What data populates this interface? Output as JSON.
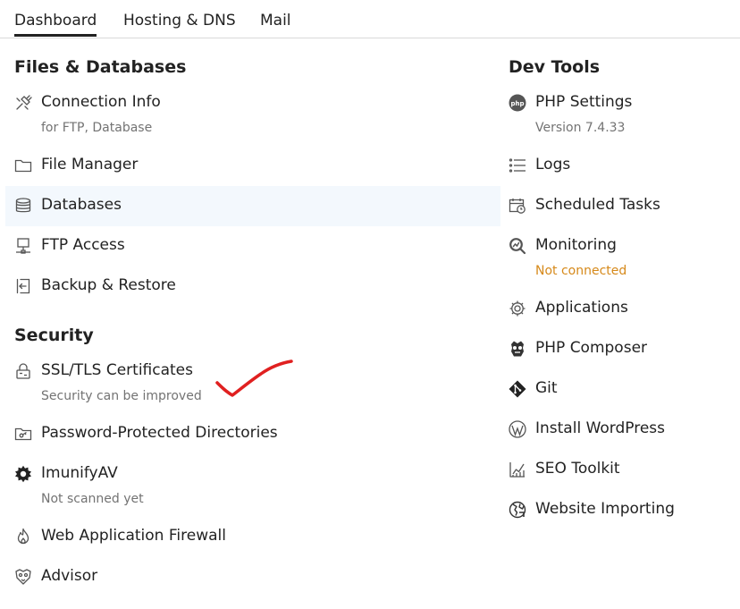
{
  "tabs": [
    {
      "label": "Dashboard",
      "active": true
    },
    {
      "label": "Hosting & DNS",
      "active": false
    },
    {
      "label": "Mail",
      "active": false
    }
  ],
  "left": {
    "files_title": "Files & Databases",
    "files_items": [
      {
        "label": "Connection Info",
        "sub": "for FTP, Database",
        "icon": "plug-icon"
      },
      {
        "label": "File Manager",
        "icon": "folder-icon"
      },
      {
        "label": "Databases",
        "icon": "database-icon"
      },
      {
        "label": "FTP Access",
        "icon": "ftp-network-icon"
      },
      {
        "label": "Backup & Restore",
        "icon": "backup-icon"
      }
    ],
    "security_title": "Security",
    "security_items": [
      {
        "label": "SSL/TLS Certificates",
        "sub": "Security can be improved",
        "icon": "ssl-lock-icon"
      },
      {
        "label": "Password-Protected Directories",
        "icon": "protected-folder-icon"
      },
      {
        "label": "ImunifyAV",
        "sub": "Not scanned yet",
        "icon": "imunify-icon"
      },
      {
        "label": "Web Application Firewall",
        "icon": "firewall-flame-icon"
      },
      {
        "label": "Advisor",
        "icon": "advisor-icon"
      }
    ]
  },
  "right": {
    "title": "Dev Tools",
    "items": [
      {
        "label": "PHP Settings",
        "sub": "Version 7.4.33",
        "icon": "php-icon"
      },
      {
        "label": "Logs",
        "icon": "list-icon"
      },
      {
        "label": "Scheduled Tasks",
        "icon": "calendar-clock-icon"
      },
      {
        "label": "Monitoring",
        "sub": "Not connected",
        "icon": "monitoring-icon"
      },
      {
        "label": "Applications",
        "icon": "gear-icon"
      },
      {
        "label": "PHP Composer",
        "icon": "composer-icon"
      },
      {
        "label": "Git",
        "icon": "git-icon"
      },
      {
        "label": "Install WordPress",
        "icon": "wordpress-icon"
      },
      {
        "label": "SEO Toolkit",
        "icon": "seo-chart-icon"
      },
      {
        "label": "Website Importing",
        "icon": "globe-import-icon"
      }
    ]
  },
  "colors": {
    "text": "#222222",
    "subtext": "#737373",
    "warning": "#d6891a",
    "highlight": "#f3f8fd",
    "annotation": "#e02020"
  }
}
